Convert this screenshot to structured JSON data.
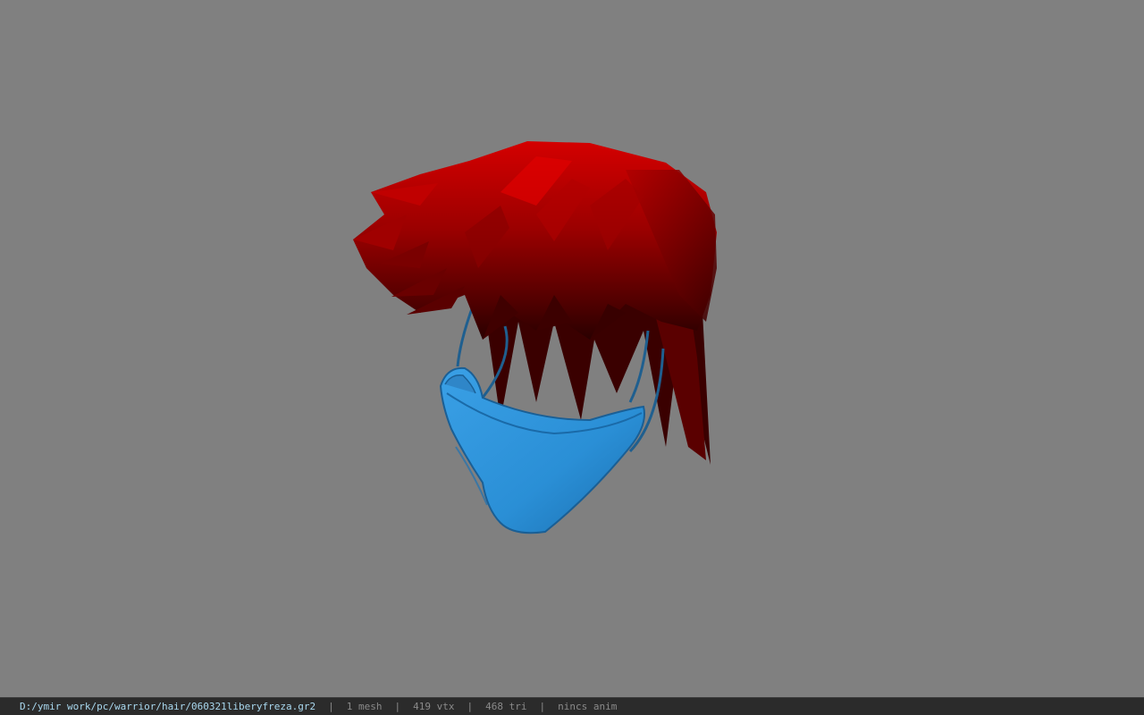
{
  "viewport": {
    "model_description_icon": "hair-and-mask-model-icon",
    "background_color": "#808080",
    "colors": {
      "hair_light": "#d00000",
      "hair_mid": "#8f0000",
      "hair_dark": "#2a0000",
      "mask": "#2a8fd6",
      "mask_shadow": "#1a6aa8",
      "strap": "#1f5f8f"
    }
  },
  "status": {
    "file_path": "D:/ymir work/pc/warrior/hair/060321liberyfreza.gr2",
    "separator": "|",
    "mesh_count": "1 mesh",
    "vertex_count": "419 vtx",
    "triangle_count": "468 tri",
    "anim_status": "nincs anim"
  }
}
